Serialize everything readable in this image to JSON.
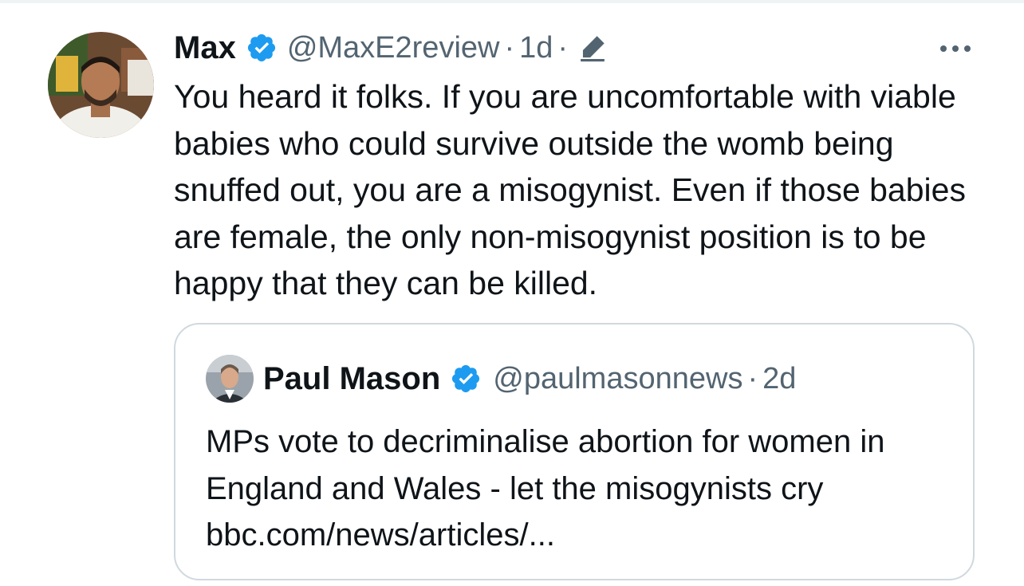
{
  "tweet": {
    "author_name": "Max",
    "author_handle": "@MaxE2review",
    "separator": "·",
    "time": "1d",
    "text": "You heard it folks. If you are uncomfortable with viable babies who could survive outside the womb being snuffed out, you are a misogynist. Even if those babies are female, the only non-misogynist position is to be happy that they can be killed."
  },
  "quoted_tweet": {
    "author_name": "Paul Mason",
    "author_handle": "@paulmasonnews",
    "separator": "·",
    "time": "2d",
    "text": "MPs vote to decriminalise abortion for women in England and Wales - let the misogynists cry",
    "link": "bbc.com/news/articles/..."
  },
  "icons": {
    "verified": "verified-badge-icon",
    "edited": "edited-pencil-icon",
    "more": "more-options-icon"
  },
  "colors": {
    "verified_blue": "#1d9bf0",
    "secondary_text": "#536471",
    "primary_text": "#0f1419",
    "border": "#cfd9de"
  }
}
